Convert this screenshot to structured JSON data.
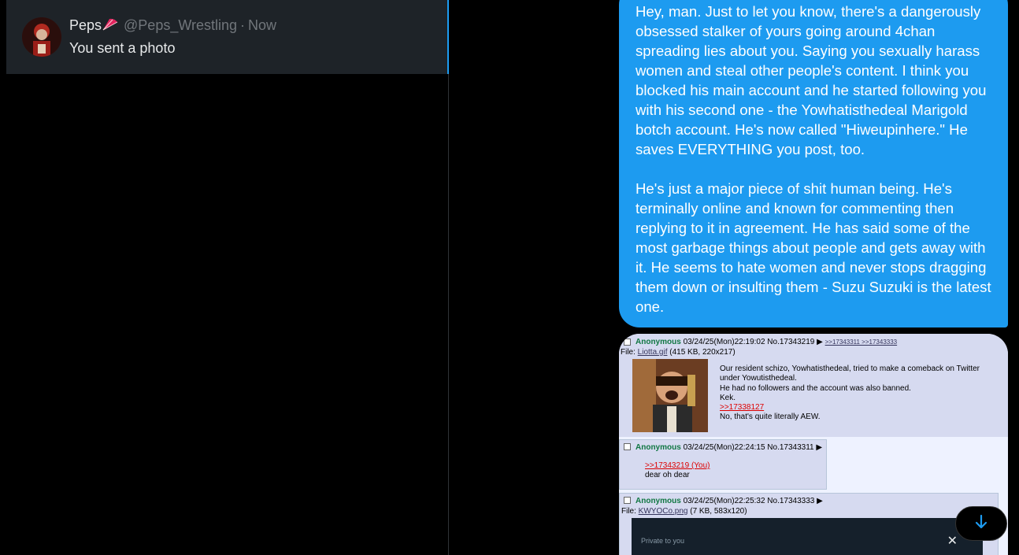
{
  "conversation": {
    "name": "Peps",
    "handle": "@Peps_Wrestling",
    "separator": "·",
    "time": "Now",
    "last_message": "You sent a photo"
  },
  "message": {
    "paragraph1": "Hey, man. Just to let you know, there's a dangerously obsessed stalker of yours going around 4chan spreading lies about you. Saying you sexually harass women and steal other people's content. I think you blocked his main account and he started following you with his second one - the Yowhatisthedeal Marigold botch account. He's now called \"Hiweupinhere.\" He saves EVERYTHING you post, too.",
    "paragraph2": "He's just a major piece of shit human being. He's terminally online and known for commenting then replying to it in agreement. He has said some of the most garbage things about people and gets away with it. He seems to hate women and never stops dragging them down or insulting them - Suzu Suzuki is the latest one."
  },
  "screenshot": {
    "post1": {
      "name": "Anonymous",
      "meta": "03/24/25(Mon)22:19:02 No.17343219 ▶",
      "replies": ">>17343311 >>17343333",
      "file_prefix": "File: ",
      "file_name": "Liotta.gif",
      "file_info": "(415 KB, 220x217)",
      "line1": "Our resident schizo, Yowhatisthedeal, tried to make a comeback on Twitter",
      "line2": "under Yowutisthedeal.",
      "line3": "He had no followers and the account was also banned.",
      "line4": "Kek.",
      "quote": ">>17338127",
      "line5": "No, that's quite literally AEW."
    },
    "post2": {
      "name": "Anonymous",
      "meta": "03/24/25(Mon)22:24:15 No.17343311 ▶",
      "quote": ">>17343219 (You)",
      "text": "dear oh dear"
    },
    "post3": {
      "name": "Anonymous",
      "meta": "03/24/25(Mon)22:25:32 No.17343333 ▶",
      "file_prefix": "File: ",
      "file_name": "KWYOCo.png",
      "file_info": "(7 KB, 583x120)",
      "embed_label": "Private to you",
      "embed_close": "✕"
    }
  },
  "icons": {
    "fan": "fan-emoji-icon",
    "scroll": "arrow-down-icon"
  },
  "colors": {
    "accent": "#1d9bf0",
    "bubble_text": "#ffffff",
    "muted": "#71767b"
  }
}
